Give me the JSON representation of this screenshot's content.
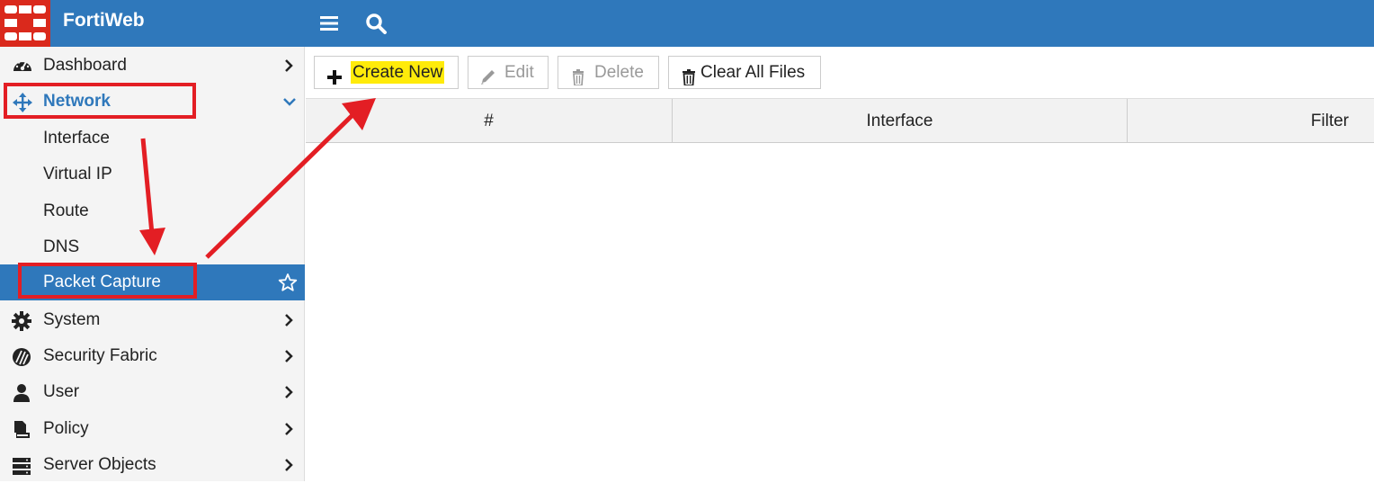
{
  "app": {
    "brand": "FortiWeb",
    "brand_color": "#2f78bb",
    "logo_color": "#da291c"
  },
  "topbar": {
    "menu_icon": "hamburger-menu-icon",
    "search_icon": "search-icon"
  },
  "sidebar": {
    "items": [
      {
        "label": "Dashboard",
        "icon": "dashboard-gauge-icon"
      },
      {
        "label": "Network",
        "icon": "network-move-icon",
        "expanded": true
      },
      {
        "label": "Interface"
      },
      {
        "label": "Virtual IP"
      },
      {
        "label": "Route"
      },
      {
        "label": "DNS"
      },
      {
        "label": "Packet Capture",
        "active": true,
        "favorite_icon": "star-outline-icon"
      },
      {
        "label": "System",
        "icon": "gear-icon"
      },
      {
        "label": "Security Fabric",
        "icon": "security-fabric-icon"
      },
      {
        "label": "User",
        "icon": "user-icon"
      },
      {
        "label": "Policy",
        "icon": "policy-icon"
      },
      {
        "label": "Server Objects",
        "icon": "server-icon"
      }
    ]
  },
  "toolbar": {
    "create_new": "Create New",
    "edit": "Edit",
    "delete": "Delete",
    "clear_all_files": "Clear All Files"
  },
  "table": {
    "columns": [
      "#",
      "Interface",
      "Filter"
    ]
  },
  "annotation_color": "#e31e24",
  "highlight_color": "#ffeb0a"
}
